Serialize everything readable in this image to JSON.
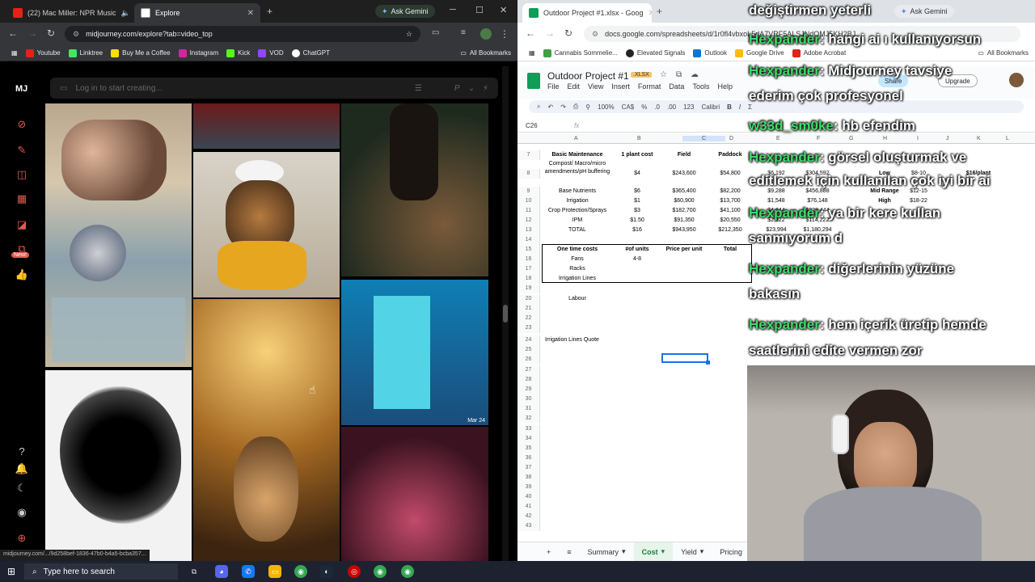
{
  "left_browser": {
    "tabs": [
      {
        "title": "(22) Mac Miller: NPR Music",
        "active": false
      },
      {
        "title": "Explore",
        "active": true
      }
    ],
    "ask_gemini": "Ask Gemini",
    "url": "midjourney.com/explore?tab=video_top",
    "bookmarks": [
      "Youtube",
      "Linktree",
      "Buy Me a Coffee",
      "Instagram",
      "Kick",
      "VOD",
      "ChatGPT"
    ],
    "all_bookmarks": "All Bookmarks",
    "status_url": "midjourney.com/.../9d258bef-1836-47b0-b4a5-bcba357..."
  },
  "midjourney": {
    "logo": "MJ",
    "search_placeholder": "Log in to start creating...",
    "new_badge": "New!",
    "tile_caption": "Mar 24"
  },
  "right_browser": {
    "tabs": [
      {
        "title": "Outdoor Project #1.xlsx - Goog",
        "active": true
      }
    ],
    "ask_gemini": "Ask Gemini",
    "url": "docs.google.com/spreadsheets/d/1r0fl4vbxoL5dA7VRF5ALSJNdQMJ5KH2BJ",
    "bookmarks": [
      "Cannabis Sommelie...",
      "Elevated Signals",
      "Outlook",
      "Google Drive",
      "Adobe Acrobat"
    ],
    "all_bookmarks": "All Bookmarks"
  },
  "sheet": {
    "title": "Outdoor Project #1",
    "badge": ".XLSX",
    "menus": [
      "File",
      "Edit",
      "View",
      "Insert",
      "Format",
      "Data",
      "Tools",
      "Help"
    ],
    "share": "Share",
    "upgrade": "Upgrade",
    "zoom": "100%",
    "currency": "CA$",
    "percent": "%",
    "decimals_less": ".0",
    "decimals_more": ".00",
    "number_format": "123",
    "font": "Calibri",
    "namebox": "C26",
    "columns": [
      "A",
      "B",
      "C",
      "D",
      "E",
      "F",
      "G",
      "H",
      "I",
      "J",
      "K",
      "L"
    ],
    "rows": {
      "r7": {
        "a": "Basic Maintenance",
        "b": "1 plant cost",
        "c": "Field",
        "d": "Paddock"
      },
      "r8": {
        "a": "Compost/ Macro/micro amendments/pH buffering",
        "b": "$4",
        "c": "$243,600",
        "d": "$54,800",
        "e": "$6,192",
        "f": "$304,592",
        "h": "Low",
        "i": "$8-10",
        "k": "$16/plant"
      },
      "r9": {
        "a": "Base Nutrients",
        "b": "$6",
        "c": "$365,400",
        "d": "$82,200",
        "e": "$9,288",
        "f": "$456,888",
        "h": "Mid Range",
        "i": "$12-15"
      },
      "r10": {
        "a": "Irrigation",
        "b": "$1",
        "c": "$60,900",
        "d": "$13,700",
        "e": "$1,548",
        "f": "$76,148",
        "h": "High",
        "i": "$18-22"
      },
      "r11": {
        "a": "Crop Protection/Sprays",
        "b": "$3",
        "c": "$182,700",
        "d": "$41,100",
        "e": "$4,644",
        "f": "$228,444"
      },
      "r12": {
        "a": "IPM",
        "b": "$1.50",
        "c": "$91,350",
        "d": "$20,550",
        "e": "$2,322",
        "f": "$114,222"
      },
      "r13": {
        "a": "TOTAL",
        "b": "$16",
        "c": "$943,950",
        "d": "$212,350",
        "e": "$23,994",
        "f": "$1,180,294"
      },
      "r15": {
        "a": "One time costs",
        "b": "#of units",
        "c": "Price per unit",
        "d": "Total"
      },
      "r16": {
        "a": "Fans",
        "b": "4-8"
      },
      "r17": {
        "a": "Racks"
      },
      "r18": {
        "a": "Irrigation Lines"
      },
      "r20": {
        "a": "Labour"
      },
      "r24": {
        "a": "Irrigation Lines Quote"
      }
    },
    "row_numbers": [
      "7",
      "8",
      "9",
      "10",
      "11",
      "12",
      "13",
      "14",
      "15",
      "16",
      "17",
      "18",
      "19",
      "20",
      "21",
      "22",
      "23",
      "24",
      "25",
      "26",
      "27",
      "28",
      "29",
      "30",
      "31",
      "32",
      "33",
      "34",
      "35",
      "36",
      "37",
      "38",
      "39",
      "40",
      "41",
      "42",
      "43"
    ],
    "sheet_tabs": [
      "Summary",
      "Cost",
      "Yield",
      "Pricing"
    ],
    "active_tab": "Cost"
  },
  "chat": [
    {
      "name": "",
      "text": "değiştirmen yeterli"
    },
    {
      "name": "Hexpander",
      "text": ": hangi ai ı kullanıyorsun"
    },
    {
      "name": "Hexpander",
      "text": ": Midjourney tavsiye"
    },
    {
      "name": "",
      "text": "ederim çok profesyonel"
    },
    {
      "name": "w33d_sm0ke",
      "text": ": hb efendim"
    },
    {
      "name": "Hexpander",
      "text": ": görsel oluşturmak ve"
    },
    {
      "name": "",
      "text": "editlemek için kullanılan çok iyi bir ai"
    },
    {
      "name": "Hexpander",
      "text": ": ya bir kere kullan"
    },
    {
      "name": "",
      "text": "sanmıyorum d"
    },
    {
      "name": "Hexpander",
      "text": ": diğerlerinin yüzüne"
    },
    {
      "name": "",
      "text": "bakasın"
    },
    {
      "name": "Hexpander",
      "text": ": hem içerik üretip hemde"
    },
    {
      "name": "",
      "text": "saatlerini edite vermen zor"
    }
  ],
  "taskbar": {
    "search_placeholder": "Type here to search"
  }
}
